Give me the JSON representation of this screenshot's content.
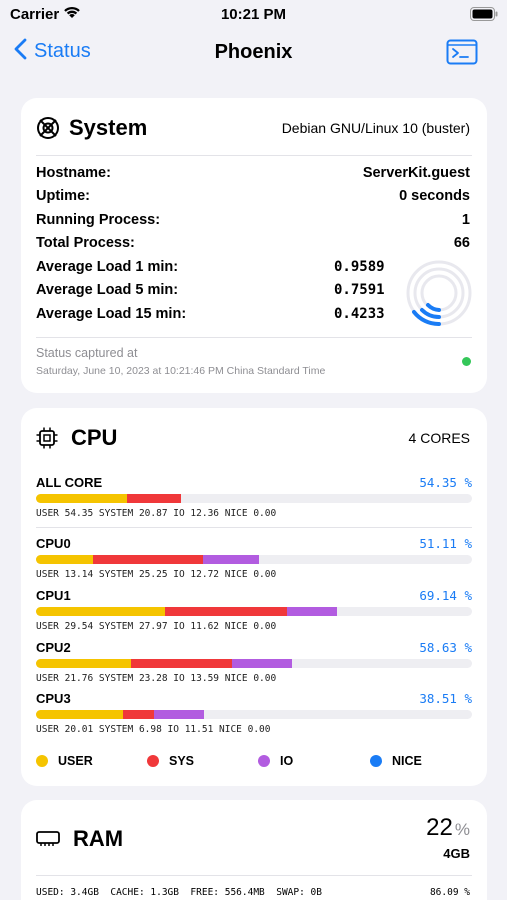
{
  "status_bar": {
    "carrier": "Carrier",
    "time": "10:21 PM"
  },
  "nav": {
    "back_label": "Status",
    "title": "Phoenix"
  },
  "system": {
    "title": "System",
    "os": "Debian GNU/Linux 10 (buster)",
    "rows": [
      {
        "label": "Hostname:",
        "value": "ServerKit.guest"
      },
      {
        "label": "Uptime:",
        "value": "0 seconds"
      },
      {
        "label": "Running Process:",
        "value": "1"
      },
      {
        "label": "Total Process:",
        "value": "66"
      }
    ],
    "loads": [
      {
        "label": "Average Load 1 min:",
        "value": "0.9589"
      },
      {
        "label": "Average Load 5 min:",
        "value": "0.7591"
      },
      {
        "label": "Average Load 15 min:",
        "value": "0.4233"
      }
    ],
    "captured_title": "Status captured at",
    "captured_time": "Saturday, June 10, 2023 at 10:21:46 PM China Standard Time",
    "status_color": "#34c759"
  },
  "cpu": {
    "title": "CPU",
    "cores_label": "4 CORES",
    "colors": {
      "user": "#f5c400",
      "sys": "#f0383a",
      "io": "#b25ce0",
      "nice": "#1a7cf5",
      "track": "#eeeef2"
    },
    "cores": [
      {
        "name": "ALL CORE",
        "percent": "54.35 %",
        "user": 20.87,
        "sys": 12.36,
        "io": 0.0,
        "nice": 0.0,
        "detail": "USER 54.35 SYSTEM 20.87 IO 12.36 NICE 0.00"
      },
      {
        "name": "CPU0",
        "percent": "51.11 %",
        "user": 13.14,
        "sys": 25.25,
        "io": 12.72,
        "nice": 0.0,
        "detail": "USER 13.14 SYSTEM 25.25 IO 12.72 NICE 0.00"
      },
      {
        "name": "CPU1",
        "percent": "69.14 %",
        "user": 29.54,
        "sys": 27.97,
        "io": 11.62,
        "nice": 0.0,
        "detail": "USER 29.54 SYSTEM 27.97 IO 11.62 NICE 0.00"
      },
      {
        "name": "CPU2",
        "percent": "58.63 %",
        "user": 21.76,
        "sys": 23.28,
        "io": 13.59,
        "nice": 0.0,
        "detail": "USER 21.76 SYSTEM 23.28 IO 13.59 NICE 0.00"
      },
      {
        "name": "CPU3",
        "percent": "38.51 %",
        "user": 20.01,
        "sys": 6.98,
        "io": 11.51,
        "nice": 0.0,
        "detail": "USER 20.01 SYSTEM 6.98 IO 11.51 NICE 0.00"
      }
    ],
    "legend": [
      "USER",
      "SYS",
      "IO",
      "NICE"
    ]
  },
  "ram": {
    "title": "RAM",
    "percent": "22",
    "percent_unit": "%",
    "total": "4GB",
    "detail": "USED: 3.4GB  CACHE: 1.3GB  FREE: 556.4MB  SWAP: 0B",
    "usage": "86.09 %"
  }
}
